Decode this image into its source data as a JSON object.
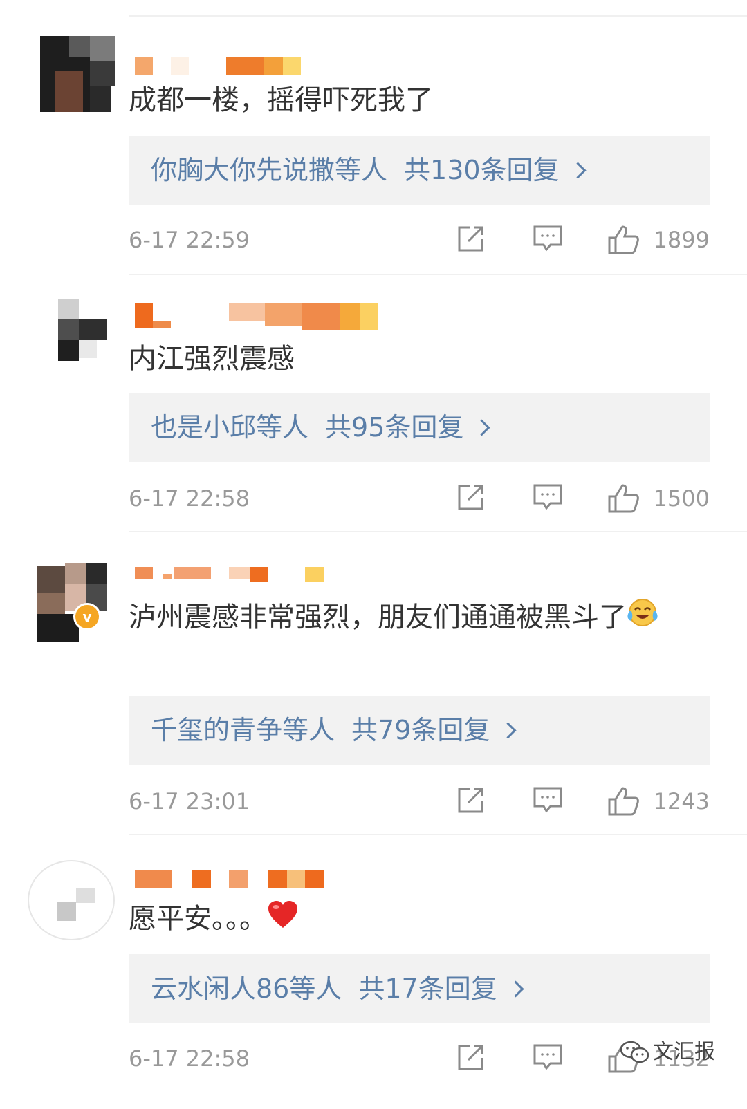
{
  "comments": [
    {
      "text": "成都一楼，摇得吓死我了",
      "reply": {
        "users": "你胸大你先说撒等人",
        "count": "共130条回复"
      },
      "time": "6-17 22:59",
      "likes": "1899"
    },
    {
      "text": "内江强烈震感",
      "reply": {
        "users": "也是小邱等人",
        "count": "共95条回复"
      },
      "time": "6-17 22:58",
      "likes": "1500"
    },
    {
      "text": "泸州震感非常强烈，朋友们通通被黑斗了",
      "emoji": "laughing-crying-emoji",
      "verified_badge": "v",
      "reply": {
        "users": "千玺的青争等人",
        "count": "共79条回复"
      },
      "time": "6-17 23:01",
      "likes": "1243"
    },
    {
      "text": "愿平安。。。",
      "emoji": "red-heart-emoji",
      "reply": {
        "users": "云水闲人86等人",
        "count": "共17条回复"
      },
      "time": "6-17 22:58",
      "likes": "1132"
    }
  ],
  "watermark": {
    "text": "文汇报"
  },
  "icons": {
    "share": "share-icon",
    "comment": "comment-icon",
    "like": "thumbs-up-icon"
  },
  "colors": {
    "reply_link": "#5a7ea8",
    "meta_gray": "#999999",
    "reply_bg": "#f2f2f2",
    "name_blur": "#f07a30"
  }
}
